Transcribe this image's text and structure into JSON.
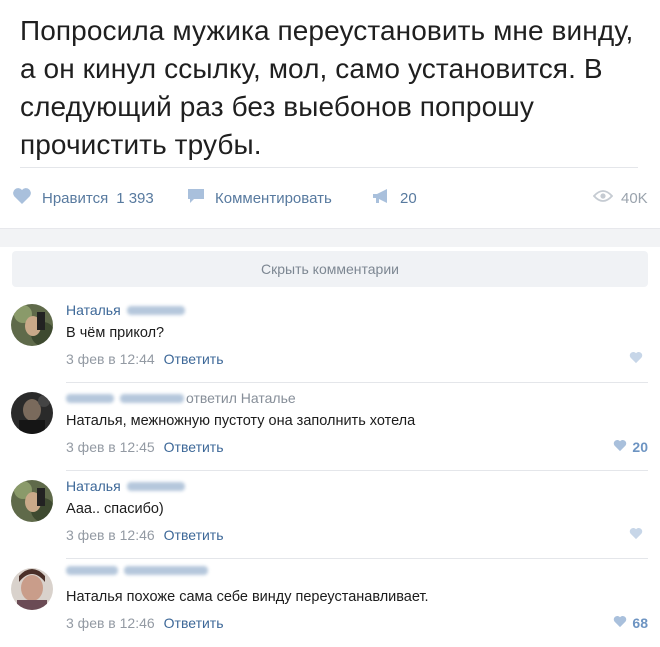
{
  "post": {
    "text": "Попросила мужика переустановить мне винду, а он кинул ссылку, мол, само установится. В следующий раз без выебонов попрошу прочистить трубы."
  },
  "actions": {
    "like_label": "Нравится",
    "like_count": "1 393",
    "comment_label": "Комментировать",
    "share_count": "20",
    "views_count": "40K"
  },
  "hide_comments_label": "Скрыть комментарии",
  "comments": [
    {
      "author": "Наталья",
      "reply_to": "",
      "text": "В чём прикол?",
      "time": "3 фев в 12:44",
      "reply_label": "Ответить",
      "likes": ""
    },
    {
      "author": "",
      "reply_to": "ответил Наталье",
      "text": "Наталья, межножную пустоту она заполнить хотела",
      "time": "3 фев в 12:45",
      "reply_label": "Ответить",
      "likes": "20"
    },
    {
      "author": "Наталья",
      "reply_to": "",
      "text": "Ааа.. спасибо)",
      "time": "3 фев в 12:46",
      "reply_label": "Ответить",
      "likes": ""
    },
    {
      "author": "",
      "reply_to": "",
      "text": "Наталья похоже сама себе винду переустанавливает.",
      "time": "3 фев в 12:46",
      "reply_label": "Ответить",
      "likes": "68"
    }
  ],
  "colors": {
    "link": "#3d6898",
    "action": "#587a9f",
    "like_heart": "#a9c0dc",
    "muted": "#939aa3"
  }
}
